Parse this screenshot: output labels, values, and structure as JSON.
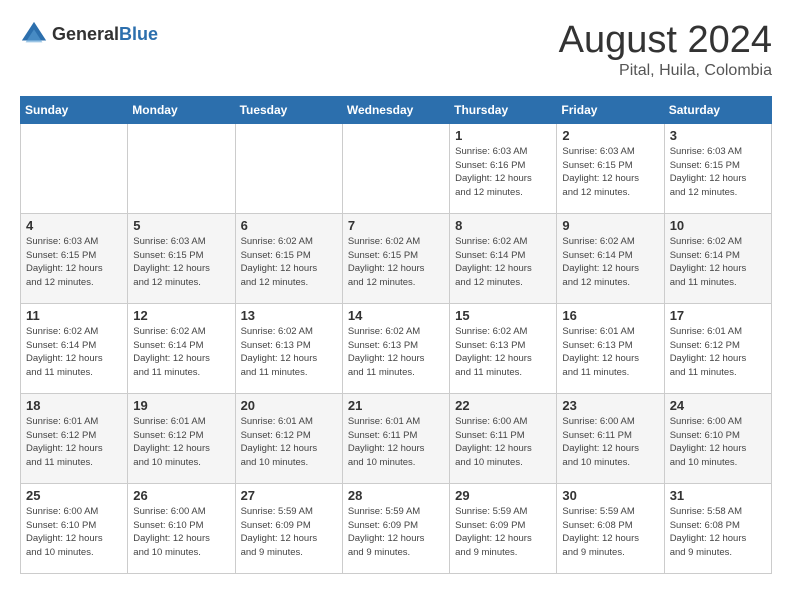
{
  "header": {
    "logo": {
      "general": "General",
      "blue": "Blue"
    },
    "title": "August 2024",
    "location": "Pital, Huila, Colombia"
  },
  "weekdays": [
    "Sunday",
    "Monday",
    "Tuesday",
    "Wednesday",
    "Thursday",
    "Friday",
    "Saturday"
  ],
  "weeks": [
    [
      {
        "day": "",
        "info": ""
      },
      {
        "day": "",
        "info": ""
      },
      {
        "day": "",
        "info": ""
      },
      {
        "day": "",
        "info": ""
      },
      {
        "day": "1",
        "info": "Sunrise: 6:03 AM\nSunset: 6:16 PM\nDaylight: 12 hours\nand 12 minutes."
      },
      {
        "day": "2",
        "info": "Sunrise: 6:03 AM\nSunset: 6:15 PM\nDaylight: 12 hours\nand 12 minutes."
      },
      {
        "day": "3",
        "info": "Sunrise: 6:03 AM\nSunset: 6:15 PM\nDaylight: 12 hours\nand 12 minutes."
      }
    ],
    [
      {
        "day": "4",
        "info": "Sunrise: 6:03 AM\nSunset: 6:15 PM\nDaylight: 12 hours\nand 12 minutes."
      },
      {
        "day": "5",
        "info": "Sunrise: 6:03 AM\nSunset: 6:15 PM\nDaylight: 12 hours\nand 12 minutes."
      },
      {
        "day": "6",
        "info": "Sunrise: 6:02 AM\nSunset: 6:15 PM\nDaylight: 12 hours\nand 12 minutes."
      },
      {
        "day": "7",
        "info": "Sunrise: 6:02 AM\nSunset: 6:15 PM\nDaylight: 12 hours\nand 12 minutes."
      },
      {
        "day": "8",
        "info": "Sunrise: 6:02 AM\nSunset: 6:14 PM\nDaylight: 12 hours\nand 12 minutes."
      },
      {
        "day": "9",
        "info": "Sunrise: 6:02 AM\nSunset: 6:14 PM\nDaylight: 12 hours\nand 12 minutes."
      },
      {
        "day": "10",
        "info": "Sunrise: 6:02 AM\nSunset: 6:14 PM\nDaylight: 12 hours\nand 11 minutes."
      }
    ],
    [
      {
        "day": "11",
        "info": "Sunrise: 6:02 AM\nSunset: 6:14 PM\nDaylight: 12 hours\nand 11 minutes."
      },
      {
        "day": "12",
        "info": "Sunrise: 6:02 AM\nSunset: 6:14 PM\nDaylight: 12 hours\nand 11 minutes."
      },
      {
        "day": "13",
        "info": "Sunrise: 6:02 AM\nSunset: 6:13 PM\nDaylight: 12 hours\nand 11 minutes."
      },
      {
        "day": "14",
        "info": "Sunrise: 6:02 AM\nSunset: 6:13 PM\nDaylight: 12 hours\nand 11 minutes."
      },
      {
        "day": "15",
        "info": "Sunrise: 6:02 AM\nSunset: 6:13 PM\nDaylight: 12 hours\nand 11 minutes."
      },
      {
        "day": "16",
        "info": "Sunrise: 6:01 AM\nSunset: 6:13 PM\nDaylight: 12 hours\nand 11 minutes."
      },
      {
        "day": "17",
        "info": "Sunrise: 6:01 AM\nSunset: 6:12 PM\nDaylight: 12 hours\nand 11 minutes."
      }
    ],
    [
      {
        "day": "18",
        "info": "Sunrise: 6:01 AM\nSunset: 6:12 PM\nDaylight: 12 hours\nand 11 minutes."
      },
      {
        "day": "19",
        "info": "Sunrise: 6:01 AM\nSunset: 6:12 PM\nDaylight: 12 hours\nand 10 minutes."
      },
      {
        "day": "20",
        "info": "Sunrise: 6:01 AM\nSunset: 6:12 PM\nDaylight: 12 hours\nand 10 minutes."
      },
      {
        "day": "21",
        "info": "Sunrise: 6:01 AM\nSunset: 6:11 PM\nDaylight: 12 hours\nand 10 minutes."
      },
      {
        "day": "22",
        "info": "Sunrise: 6:00 AM\nSunset: 6:11 PM\nDaylight: 12 hours\nand 10 minutes."
      },
      {
        "day": "23",
        "info": "Sunrise: 6:00 AM\nSunset: 6:11 PM\nDaylight: 12 hours\nand 10 minutes."
      },
      {
        "day": "24",
        "info": "Sunrise: 6:00 AM\nSunset: 6:10 PM\nDaylight: 12 hours\nand 10 minutes."
      }
    ],
    [
      {
        "day": "25",
        "info": "Sunrise: 6:00 AM\nSunset: 6:10 PM\nDaylight: 12 hours\nand 10 minutes."
      },
      {
        "day": "26",
        "info": "Sunrise: 6:00 AM\nSunset: 6:10 PM\nDaylight: 12 hours\nand 10 minutes."
      },
      {
        "day": "27",
        "info": "Sunrise: 5:59 AM\nSunset: 6:09 PM\nDaylight: 12 hours\nand 9 minutes."
      },
      {
        "day": "28",
        "info": "Sunrise: 5:59 AM\nSunset: 6:09 PM\nDaylight: 12 hours\nand 9 minutes."
      },
      {
        "day": "29",
        "info": "Sunrise: 5:59 AM\nSunset: 6:09 PM\nDaylight: 12 hours\nand 9 minutes."
      },
      {
        "day": "30",
        "info": "Sunrise: 5:59 AM\nSunset: 6:08 PM\nDaylight: 12 hours\nand 9 minutes."
      },
      {
        "day": "31",
        "info": "Sunrise: 5:58 AM\nSunset: 6:08 PM\nDaylight: 12 hours\nand 9 minutes."
      }
    ]
  ]
}
